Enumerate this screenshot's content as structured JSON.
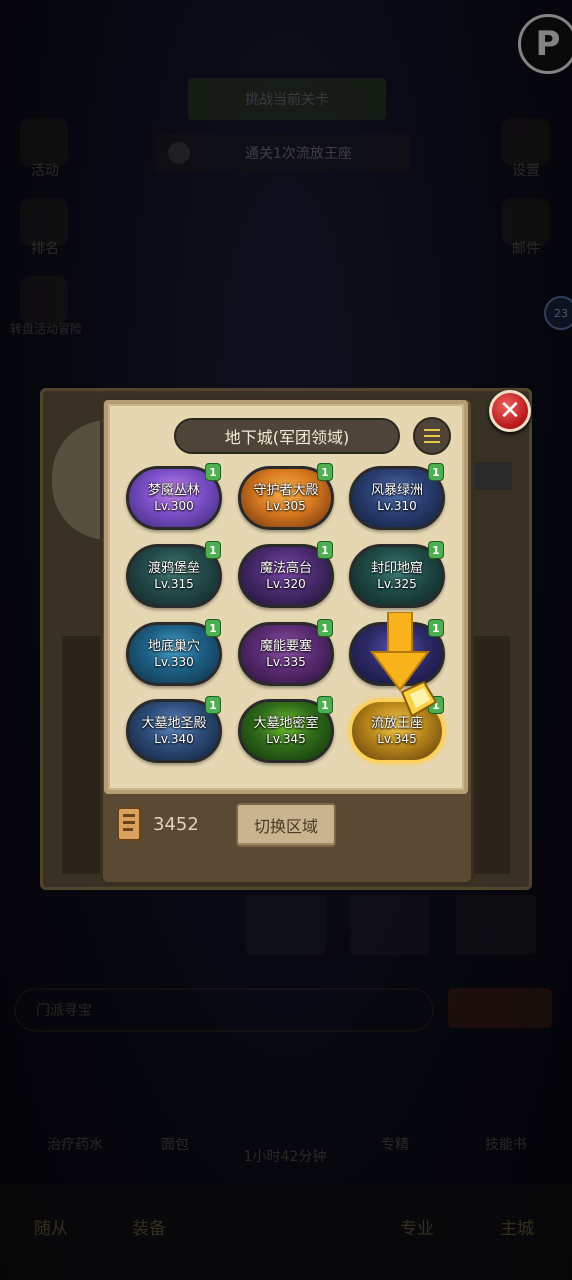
{
  "background": {
    "banner_text": "挑战当前关卡",
    "strip_text": "通关1次流放王座",
    "left_icons": [
      "活动",
      "排名",
      "转盘活动冒险"
    ],
    "right_icons": [
      "设置",
      "邮件"
    ],
    "input_placeholder": "门派寻宝",
    "items": [
      "治疗药水",
      "面包",
      "1小时42分钟",
      "专精",
      "技能书"
    ],
    "nav": [
      "随从",
      "装备",
      "专业",
      "主城"
    ],
    "side_badge": "23"
  },
  "panel": {
    "title": "地下城(军团领域)",
    "dungeons": [
      {
        "name": "梦魇丛林",
        "level": "Lv.300",
        "count": "1",
        "colors": [
          "#7c4fc9",
          "#c383e6",
          "#3b2a73"
        ]
      },
      {
        "name": "守护者大殿",
        "level": "Lv.305",
        "count": "1",
        "colors": [
          "#d87a1f",
          "#f3b04e",
          "#6b2f0e"
        ]
      },
      {
        "name": "风暴绿洲",
        "level": "Lv.310",
        "count": "1",
        "colors": [
          "#2a3f72",
          "#4f6fad",
          "#111f3a"
        ]
      },
      {
        "name": "渡鸦堡垒",
        "level": "Lv.315",
        "count": "1",
        "colors": [
          "#244a4a",
          "#3f7a72",
          "#112626"
        ]
      },
      {
        "name": "魔法高台",
        "level": "Lv.320",
        "count": "1",
        "colors": [
          "#4a2b6e",
          "#7b48a8",
          "#1d1234"
        ]
      },
      {
        "name": "封印地窟",
        "level": "Lv.325",
        "count": "1",
        "colors": [
          "#1f4a45",
          "#3c7f76",
          "#0f2522"
        ]
      },
      {
        "name": "地底巢穴",
        "level": "Lv.330",
        "count": "1",
        "colors": [
          "#1d5f84",
          "#45a2c9",
          "#0f2f44"
        ]
      },
      {
        "name": "魔能要塞",
        "level": "Lv.335",
        "count": "1",
        "colors": [
          "#5a2c73",
          "#8d52a6",
          "#2a1238"
        ]
      },
      {
        "name": "",
        "level": "",
        "count": "1",
        "colors": [
          "#2e2b6a",
          "#5a58b8",
          "#141336"
        ]
      },
      {
        "name": "大墓地圣殿",
        "level": "Lv.340",
        "count": "1",
        "colors": [
          "#2c4d7a",
          "#5f86c1",
          "#121f36"
        ]
      },
      {
        "name": "大墓地密室",
        "level": "Lv.345",
        "count": "1",
        "colors": [
          "#2f6b1a",
          "#6fc02a",
          "#12300a"
        ]
      },
      {
        "name": "流放王座",
        "level": "Lv.345",
        "count": "1",
        "colors": [
          "#b8861b",
          "#f4c84b",
          "#5a3a0b"
        ]
      }
    ],
    "currency_value": "3452",
    "switch_label": "切换区域"
  },
  "colors": {
    "panel_bg": "#e6d7b3",
    "count_badge": "#4caf50",
    "close": "#c81e1e",
    "arrow": "#f7b21c"
  }
}
